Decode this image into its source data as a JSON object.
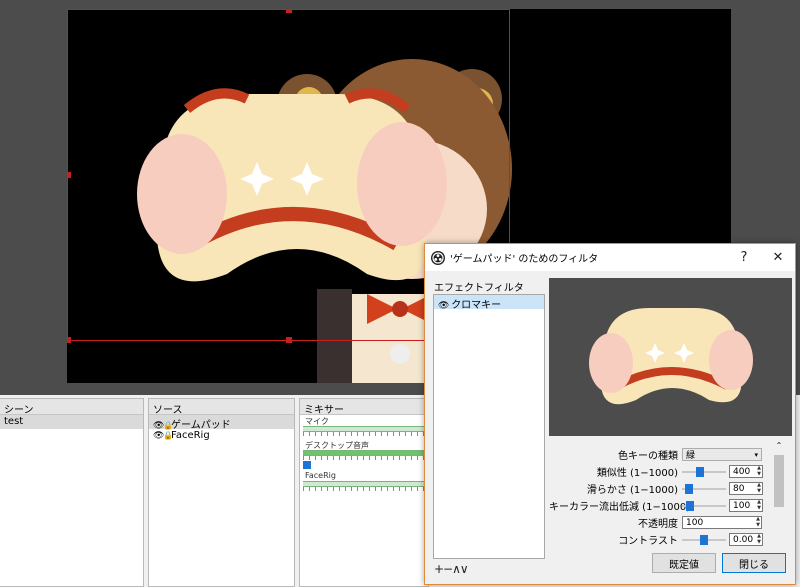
{
  "preview": {
    "has_canvas": true
  },
  "docks": {
    "scenes": {
      "title": "シーン",
      "items": [
        "test"
      ]
    },
    "sources": {
      "title": "ソース",
      "items": [
        {
          "label": "ゲームパッド",
          "selected": true
        },
        {
          "label": "FaceRig",
          "selected": false
        }
      ]
    },
    "mixer": {
      "title": "ミキサー",
      "tracks": [
        {
          "label": "マイク",
          "active": false
        },
        {
          "label": "デスクトップ音声",
          "active": true
        },
        {
          "label": "FaceRig",
          "active": false
        }
      ]
    }
  },
  "dialog": {
    "title": "'ゲームパッド' のためのフィルタ",
    "help": "?",
    "close": "✕",
    "effect_filters_label": "エフェクトフィルタ",
    "filters": [
      {
        "label": "クロマキー",
        "visible": true
      }
    ],
    "list_controls": "+−∧∨",
    "properties": {
      "key_color_type": {
        "label": "色キーの種類",
        "value": "緑"
      },
      "similarity": {
        "label": "類似性 (1−1000)",
        "value": "400",
        "level": 0.4
      },
      "smoothness": {
        "label": "滑らかさ (1−1000)",
        "value": "80",
        "level": 0.08
      },
      "spill": {
        "label": "キーカラー流出低減 (1−1000)",
        "value": "100",
        "level": 0.1
      },
      "opacity": {
        "label": "不透明度",
        "value": "100"
      },
      "contrast": {
        "label": "コントラスト",
        "value": "0.00",
        "level": 0.5
      }
    },
    "defaults_button": "既定値",
    "close_button": "閉じる"
  },
  "colors": {
    "accent": "#1e73d6",
    "bbox": "#c8201f",
    "dialog_border": "#e08a40"
  }
}
